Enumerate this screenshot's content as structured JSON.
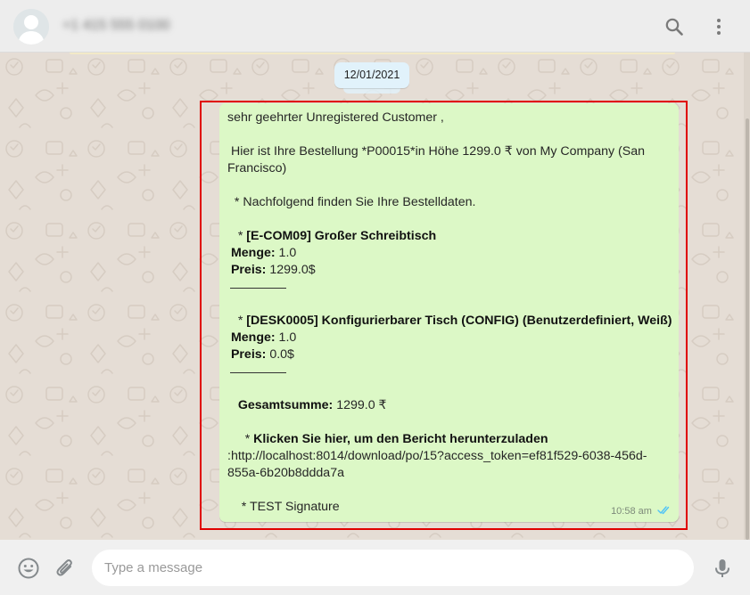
{
  "header": {
    "contact_name": "+1 415 555 0100",
    "icons": {
      "search": "search-icon",
      "menu": "more-vertical-icon",
      "avatar": "default-avatar-icon"
    }
  },
  "chat": {
    "date_label": "12/01/2021",
    "message": {
      "greeting": "sehr geehrter Unregistered Customer ,",
      "intro_line1": " Hier ist Ihre Bestellung *P00015*in Höhe 1299.0 ₹ von My Company (San",
      "intro_line2": "Francisco)",
      "details_line": "  * Nachfolgend finden Sie Ihre Bestelldaten.",
      "items": [
        {
          "bullet": "   * ",
          "name": "[E-COM09] Großer Schreibtisch",
          "qty_label": "Menge:",
          "qty": " 1.0",
          "price_label": "Preis:",
          "price": " 1299.0$"
        },
        {
          "bullet": "   * ",
          "name": "[DESK0005] Konfigurierbarer Tisch (CONFIG) (Benutzerdefiniert, Weiß)",
          "qty_label": "Menge:",
          "qty": " 1.0",
          "price_label": "Preis:",
          "price": " 0.0$"
        }
      ],
      "total_label": "Gesamtsumme:",
      "total_value": " 1299.0 ₹",
      "link_bullet": "     * ",
      "link_label": "Klicken Sie hier, um den Bericht herunterzuladen",
      "link_line1": ":http://localhost:8014/download/po/15?access_token=ef81f529-6038-456d-",
      "link_line2": "855a-6b20b8ddda7a",
      "signature": "    * TEST Signature",
      "time": "10:58 am",
      "status_icon": "double-check-read-icon"
    }
  },
  "composer": {
    "placeholder": "Type a message",
    "icons": {
      "emoji": "emoji-icon",
      "attach": "paperclip-icon",
      "mic": "microphone-icon"
    }
  },
  "colors": {
    "header_bg": "#ededed",
    "chat_bg": "#e5ddd5",
    "outgoing_bubble": "#dcf8c6",
    "date_pill": "#e1f2fb",
    "highlight_border": "#e00000",
    "read_ticks": "#4fc3f7"
  }
}
